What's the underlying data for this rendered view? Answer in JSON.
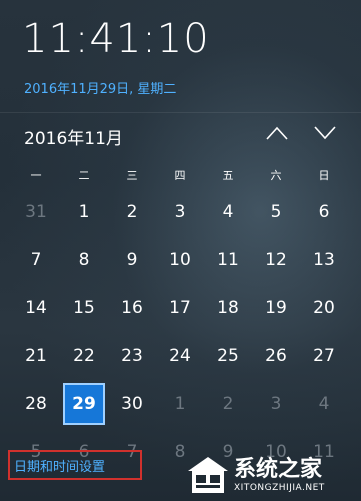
{
  "clock": {
    "time": "11:41:10",
    "date": "2016年11月29日, 星期二"
  },
  "calendar": {
    "month_title": "2016年11月",
    "weekdays": [
      "一",
      "二",
      "三",
      "四",
      "五",
      "六",
      "日"
    ],
    "weeks": [
      [
        "31",
        "1",
        "2",
        "3",
        "4",
        "5",
        "6"
      ],
      [
        "7",
        "8",
        "9",
        "10",
        "11",
        "12",
        "13"
      ],
      [
        "14",
        "15",
        "16",
        "17",
        "18",
        "19",
        "20"
      ],
      [
        "21",
        "22",
        "23",
        "24",
        "25",
        "26",
        "27"
      ],
      [
        "28",
        "29",
        "30",
        "1",
        "2",
        "3",
        "4"
      ],
      [
        "5",
        "6",
        "7",
        "8",
        "9",
        "10",
        "11"
      ]
    ],
    "today": "29"
  },
  "footer": {
    "settings_label": "日期和时间设置"
  },
  "watermark": {
    "cn": "系统之家",
    "en": "XITONGZHIJIA.NET"
  },
  "colors": {
    "accent": "#1677d8",
    "link": "#4fb1ff",
    "highlight_box": "#d0312d"
  },
  "icons": {
    "prev": "chevron-up-icon",
    "next": "chevron-down-icon",
    "logo": "xitongzhijia-logo-icon"
  }
}
